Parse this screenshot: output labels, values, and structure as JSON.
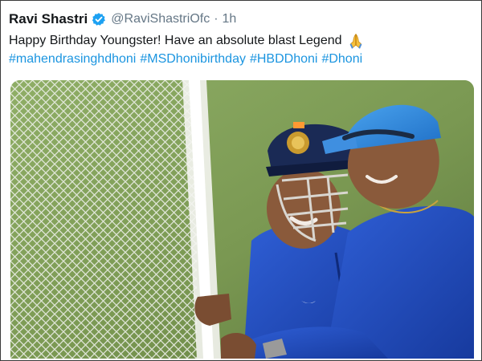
{
  "tweet": {
    "author_name": "Ravi Shastri",
    "handle": "@RaviShastriOfc",
    "separator": "·",
    "time": "1h",
    "text": "Happy Birthday Youngster! Have an absolute blast Legend",
    "emoji": "folded-hands",
    "hashtags": [
      "#mahendrasinghdhoni",
      "#MSDhonibirthday",
      "#HBDDhoni",
      "#Dhoni"
    ],
    "media": {
      "kind": "photo",
      "subject": "two cricketers smiling beside practice nets"
    }
  },
  "colors": {
    "text": "#14171a",
    "secondary": "#657786",
    "link": "#1b95e0",
    "verified": "#1da1f2",
    "frame": "#3b3b3b"
  }
}
